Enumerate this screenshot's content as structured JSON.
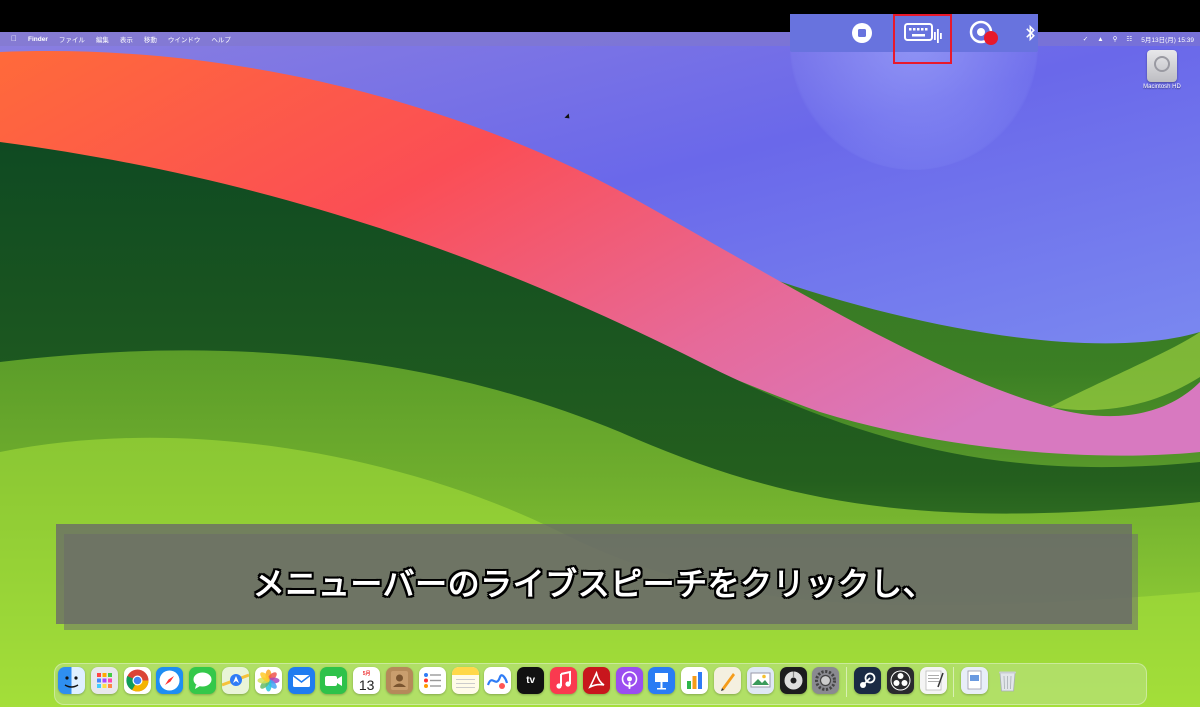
{
  "menubar": {
    "apple_icon": "apple-icon",
    "app_name": "Finder",
    "menus": [
      "ファイル",
      "編集",
      "表示",
      "移動",
      "ウインドウ",
      "ヘルプ"
    ],
    "date_time": "5月13日(月) 15:39"
  },
  "zoom_overlay": {
    "items": [
      "stop-record-icon",
      "live-speech-keyboard-icon",
      "screen-record-icon",
      "bluetooth-icon"
    ],
    "highlight_color": "#e8192c"
  },
  "desktop": {
    "drive_label": "Macintosh HD"
  },
  "caption": {
    "text": "メニューバーのライブスピーチをクリックし、"
  },
  "dock": {
    "calendar_month": "5月",
    "calendar_day": "13",
    "tv_label": "tv",
    "items": [
      {
        "name": "finder",
        "color": "#2f8ff0"
      },
      {
        "name": "launchpad",
        "color": "#e8e8ec"
      },
      {
        "name": "chrome",
        "color": "#ffffff"
      },
      {
        "name": "safari",
        "color": "#1e8ef2"
      },
      {
        "name": "messages",
        "color": "#34c84a"
      },
      {
        "name": "maps",
        "color": "#6cc070"
      },
      {
        "name": "photos",
        "color": "#ffffff"
      },
      {
        "name": "mail",
        "color": "#1f7cf0"
      },
      {
        "name": "facetime",
        "color": "#2ec24a"
      },
      {
        "name": "calendar",
        "color": "#ffffff"
      },
      {
        "name": "contacts",
        "color": "#b58a5a"
      },
      {
        "name": "reminders",
        "color": "#ffffff"
      },
      {
        "name": "notes",
        "color": "#ffd84a"
      },
      {
        "name": "freeform",
        "color": "#ffffff"
      },
      {
        "name": "apple-tv",
        "color": "#111111"
      },
      {
        "name": "music",
        "color": "#fa3a4f"
      },
      {
        "name": "acrobat",
        "color": "#c8161d"
      },
      {
        "name": "podcasts",
        "color": "#9b4ef0"
      },
      {
        "name": "keynote",
        "color": "#2a7cf4"
      },
      {
        "name": "numbers",
        "color": "#ffffff"
      },
      {
        "name": "pages",
        "color": "#f4f0e0"
      },
      {
        "name": "preview",
        "color": "#dfe8f4"
      },
      {
        "name": "disk-utility",
        "color": "#1c1c1e"
      },
      {
        "name": "system-settings",
        "color": "#8a8a90"
      },
      {
        "name": "steam",
        "color": "#1b2a44"
      },
      {
        "name": "obs",
        "color": "#2a2a2e"
      },
      {
        "name": "textedit",
        "color": "#f4f4f4"
      },
      {
        "name": "downloads-stack",
        "color": "#e8eef8"
      },
      {
        "name": "trash",
        "color": "#d8dde2"
      }
    ]
  }
}
